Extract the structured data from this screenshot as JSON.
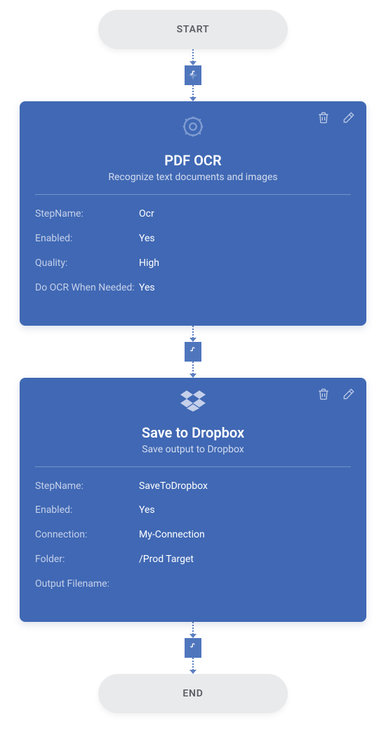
{
  "start_label": "START",
  "end_label": "END",
  "card1": {
    "title": "PDF OCR",
    "subtitle": "Recognize text documents and images",
    "icon": "gear-icon",
    "fields": [
      {
        "label": "StepName:",
        "value": "Ocr"
      },
      {
        "label": "Enabled:",
        "value": "Yes"
      },
      {
        "label": "Quality:",
        "value": "High"
      },
      {
        "label": "Do OCR When Needed:",
        "value": "Yes"
      }
    ]
  },
  "card2": {
    "title": "Save to Dropbox",
    "subtitle": "Save output to Dropbox",
    "icon": "dropbox-icon",
    "fields": [
      {
        "label": "StepName:",
        "value": "SaveToDropbox"
      },
      {
        "label": "Enabled:",
        "value": "Yes"
      },
      {
        "label": "Connection:",
        "value": "My-Connection"
      },
      {
        "label": "Folder:",
        "value": "/Prod Target"
      },
      {
        "label": "Output Filename:",
        "value": ""
      }
    ]
  },
  "connector_icon": "pdf-icon",
  "colors": {
    "primary": "#4068b4",
    "badge": "#4f76bd",
    "pill": "#e9eaec"
  }
}
